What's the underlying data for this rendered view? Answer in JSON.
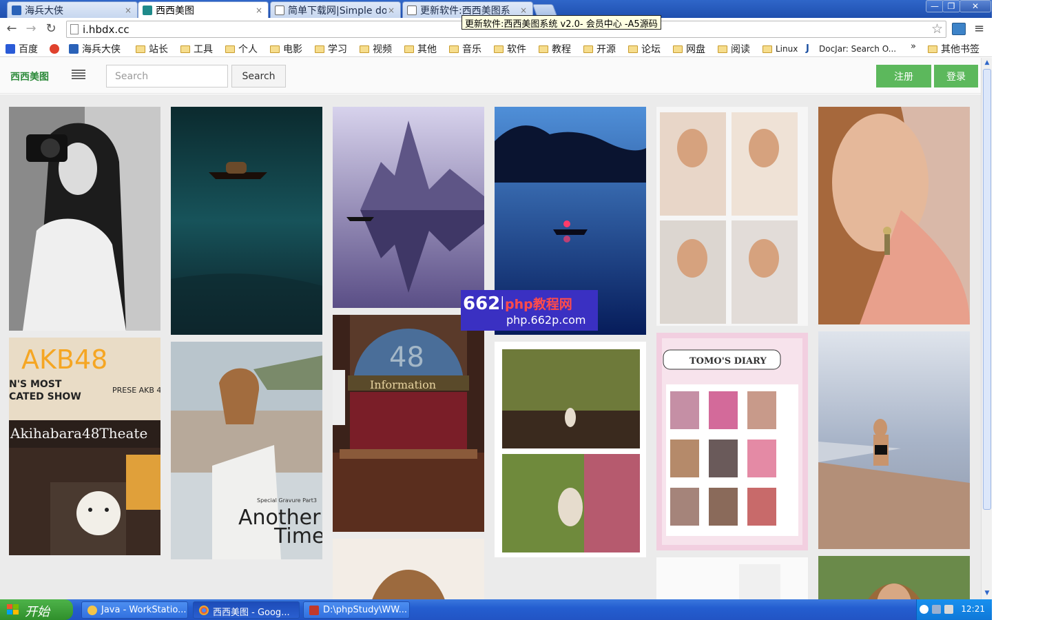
{
  "browser": {
    "tabs": [
      {
        "title": "海兵大侠",
        "close": "×"
      },
      {
        "title": "西西美图",
        "close": "×"
      },
      {
        "title": "简单下载网|Simple do",
        "close": "×"
      },
      {
        "title": "更新软件:西西美图系",
        "close": "×"
      }
    ],
    "window_controls": {
      "minimize": "—",
      "restore": "❐",
      "close": "✕"
    },
    "url": "i.hbdx.cc",
    "tooltip": "更新软件:西西美图系统 v2.0- 会员中心 -A5源码",
    "nav": {
      "back": "←",
      "forward": "→",
      "reload": "↻",
      "star": "☆",
      "menu": "≡"
    }
  },
  "bookmarks": [
    {
      "label": "百度",
      "type": "site"
    },
    {
      "label": "",
      "type": "site"
    },
    {
      "label": "海兵大侠",
      "type": "site"
    },
    {
      "label": "站长",
      "type": "folder"
    },
    {
      "label": "工具",
      "type": "folder"
    },
    {
      "label": "个人",
      "type": "folder"
    },
    {
      "label": "电影",
      "type": "folder"
    },
    {
      "label": "学习",
      "type": "folder"
    },
    {
      "label": "视频",
      "type": "folder"
    },
    {
      "label": "其他",
      "type": "folder"
    },
    {
      "label": "音乐",
      "type": "folder"
    },
    {
      "label": "软件",
      "type": "folder"
    },
    {
      "label": "教程",
      "type": "folder"
    },
    {
      "label": "开源",
      "type": "folder"
    },
    {
      "label": "论坛",
      "type": "folder"
    },
    {
      "label": "网盘",
      "type": "folder"
    },
    {
      "label": "阅读",
      "type": "folder"
    },
    {
      "label": "Linux",
      "type": "folder"
    },
    {
      "label": "DocJar: Search O...",
      "type": "site"
    },
    {
      "label": "其他书签",
      "type": "folder"
    }
  ],
  "bookmarks_more": "»",
  "site": {
    "brand": "西西美图",
    "search": {
      "placeholder": "Search",
      "value": "",
      "button": "Search"
    },
    "register_label": "注册",
    "login_label": "登录"
  },
  "gallery": {
    "images": [
      {
        "subject": "woman-with-camera-bw"
      },
      {
        "subject": "boat-on-dark-lake"
      },
      {
        "subject": "karst-mountain-reflection"
      },
      {
        "subject": "night-lake-boat-lantern"
      },
      {
        "subject": "photo-collage-four"
      },
      {
        "subject": "woman-portrait-earring"
      },
      {
        "subject": "akb48-theater-sign",
        "sign_text": "AKB48",
        "sub_text_1": "N'S MOST",
        "sub_text_2": "CATED SHOW",
        "sub_text_3": "Akihabara48Theate",
        "side_text": "PRESE AKB 4"
      },
      {
        "subject": "woman-on-beach-balcony",
        "caption_small": "Special Gravure Part3",
        "caption_big_1": "Another",
        "caption_big_2": "Time"
      },
      {
        "subject": "akb48-information-desk",
        "sign_text": "48",
        "sign_label": "Information"
      },
      {
        "subject": "theater-seats-two-photos"
      },
      {
        "subject": "magazine-page-tomos-diary",
        "heading": "TOMO'S DIARY"
      },
      {
        "subject": "woman-sitting-seaside"
      },
      {
        "subject": "woman-hair-closeup"
      },
      {
        "subject": "blank-light-photo"
      },
      {
        "subject": "woman-portrait-outdoor"
      }
    ]
  },
  "watermark": {
    "logo": "662P",
    "line1": "php教程网",
    "line2": "php.662p.com"
  },
  "taskbar": {
    "start": "开始",
    "tasks": [
      {
        "label": "Java - WorkStatio..."
      },
      {
        "label": "西西美图 - Goog..."
      },
      {
        "label": "D:\\phpStudy\\WW..."
      }
    ],
    "clock": "12:21"
  },
  "colors": {
    "brand_green": "#2c8a3a",
    "button_green": "#5cb85c",
    "taskbar_blue": "#245ed0",
    "start_green": "#3a9a34"
  }
}
